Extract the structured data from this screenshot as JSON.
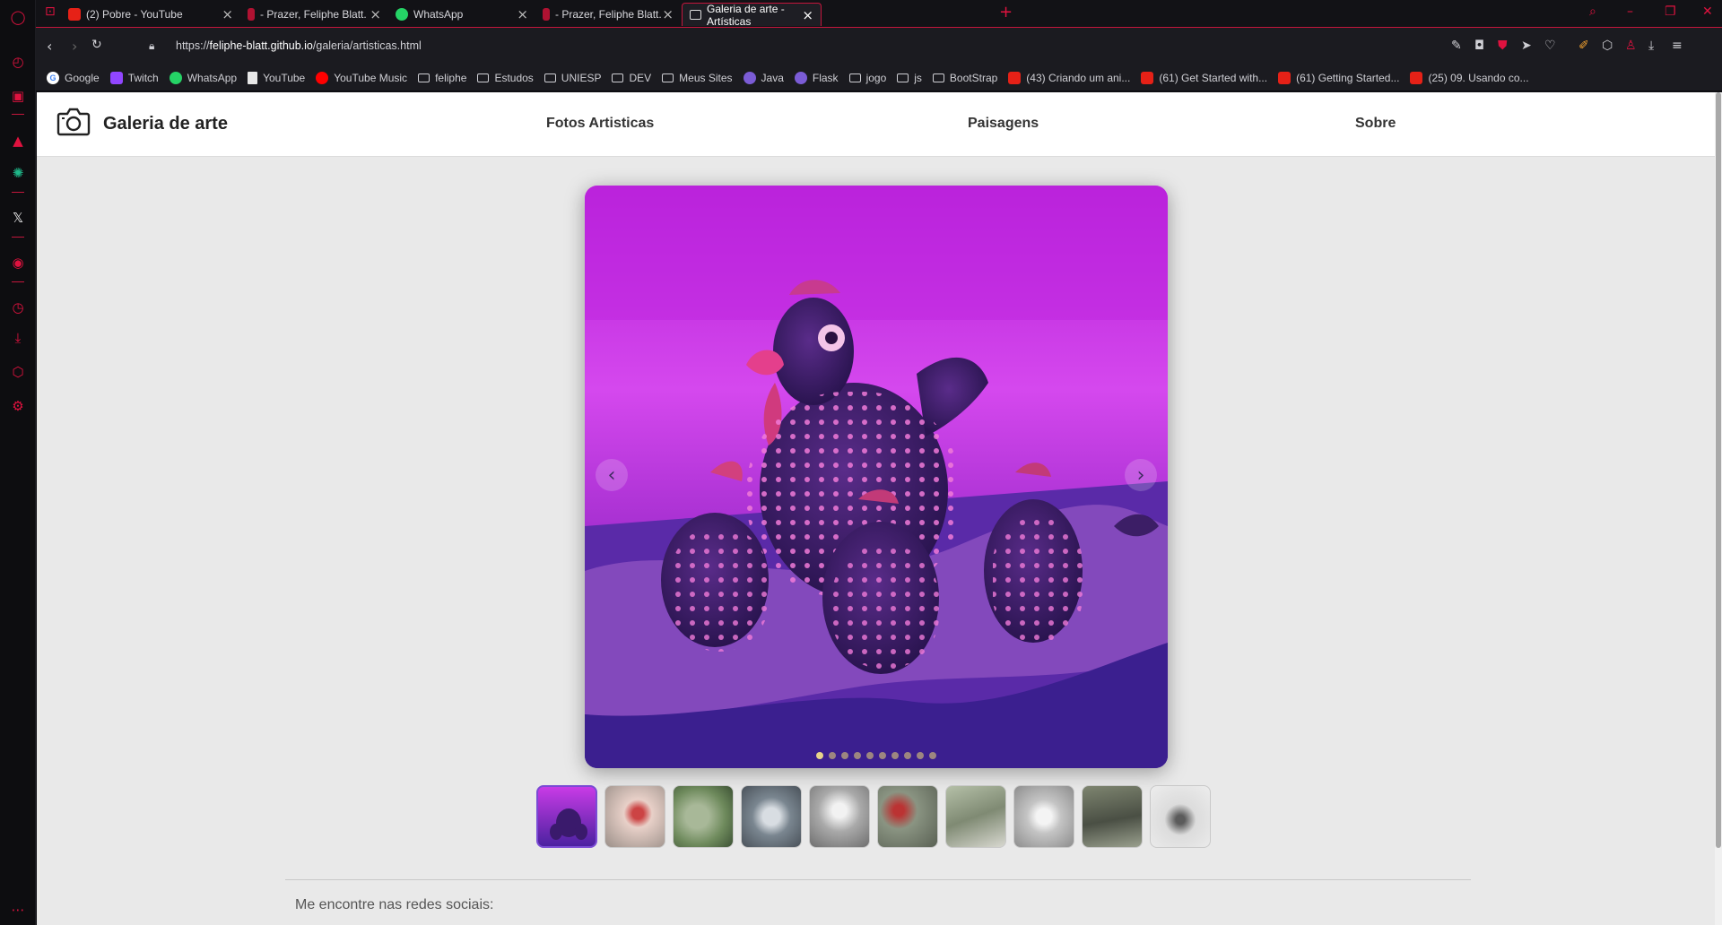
{
  "browser": {
    "tabs": [
      {
        "title": "(2) Pobre - YouTube",
        "favicon": "youtube-icon"
      },
      {
        "title": "- Prazer, Feliphe Blatt.",
        "favicon": "music-icon"
      },
      {
        "title": "WhatsApp",
        "favicon": "whatsapp-icon"
      },
      {
        "title": "- Prazer, Feliphe Blatt.",
        "favicon": "music-icon"
      },
      {
        "title": "Galeria de arte - Artísticas",
        "favicon": "camera-icon",
        "active": true
      }
    ],
    "url_prefix": "https://",
    "url_domain": "feliphe-blatt.github.io",
    "url_path": "/galeria/artisticas.html",
    "bookmarks": [
      {
        "label": "Google",
        "icon": "google-icon"
      },
      {
        "label": "Twitch",
        "icon": "twitch-icon"
      },
      {
        "label": "WhatsApp",
        "icon": "whatsapp-icon"
      },
      {
        "label": "YouTube",
        "icon": "document-icon"
      },
      {
        "label": "YouTube Music",
        "icon": "youtube-music-icon"
      },
      {
        "label": "feliphe",
        "icon": "folder-icon"
      },
      {
        "label": "Estudos",
        "icon": "folder-icon"
      },
      {
        "label": "UNIESP",
        "icon": "folder-icon"
      },
      {
        "label": "DEV",
        "icon": "folder-icon"
      },
      {
        "label": "Meus Sites",
        "icon": "folder-icon"
      },
      {
        "label": "Java",
        "icon": "python-icon"
      },
      {
        "label": "Flask",
        "icon": "python-icon"
      },
      {
        "label": "jogo",
        "icon": "folder-icon"
      },
      {
        "label": "js",
        "icon": "folder-icon"
      },
      {
        "label": "BootStrap",
        "icon": "folder-icon"
      },
      {
        "label": "(43) Criando um ani...",
        "icon": "youtube-icon"
      },
      {
        "label": "(61) Get Started with...",
        "icon": "youtube-icon"
      },
      {
        "label": "(61) Getting Started...",
        "icon": "youtube-icon"
      },
      {
        "label": "(25) 09. Usando co...",
        "icon": "youtube-icon"
      }
    ],
    "accent": "#e0123f"
  },
  "site": {
    "title": "Galeria de arte",
    "nav": {
      "artisticas": "Fotos Artisticas",
      "paisagens": "Paisagens",
      "sobre": "Sobre"
    },
    "carousel": {
      "slide_count": 10,
      "active_index": 0,
      "prev_icon": "chevron-left-icon",
      "next_icon": "chevron-right-icon"
    },
    "footer": {
      "text": "Me encontre nas redes sociais:"
    }
  }
}
